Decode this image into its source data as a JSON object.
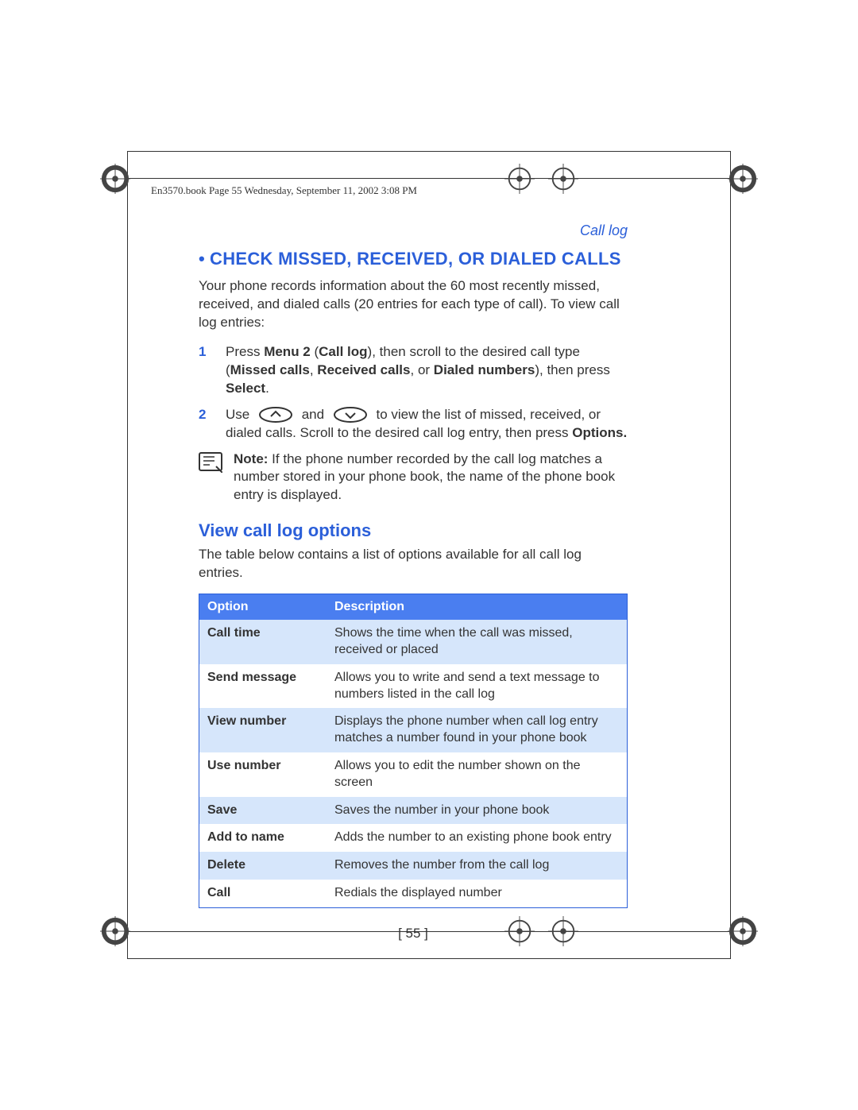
{
  "book_header": "En3570.book  Page 55  Wednesday, September 11, 2002  3:08 PM",
  "section_label": "Call log",
  "h1_bullet": "•",
  "h1": "CHECK MISSED, RECEIVED, OR DIALED CALLS",
  "intro": "Your phone records information about the 60 most recently missed, received, and dialed calls (20 entries for each type of call). To view call log entries:",
  "step1_num": "1",
  "step1_a": "Press ",
  "step1_b": "Menu 2",
  "step1_c": " (",
  "step1_d": "Call log",
  "step1_e": "), then scroll to the desired call type (",
  "step1_f": "Missed calls",
  "step1_g": ", ",
  "step1_h": "Received calls",
  "step1_i": ", or ",
  "step1_j": "Dialed numbers",
  "step1_k": "), then press ",
  "step1_l": "Select",
  "step1_m": ".",
  "step2_num": "2",
  "step2_a": "Use ",
  "step2_b": " and ",
  "step2_c": " to view the list of missed, received, or dialed calls. Scroll to the desired call log entry, then press ",
  "step2_d": "Options.",
  "note_a": "Note:",
  "note_b": " If the phone number recorded by the call log matches a number stored in your phone book, the name of the phone book entry is displayed.",
  "h2": "View call log options",
  "table_intro": "The table below contains a list of options available for all call log entries.",
  "table": {
    "header_option": "Option",
    "header_desc": "Description",
    "rows": [
      {
        "opt": "Call time",
        "desc": "Shows the time when the call was missed, received or placed"
      },
      {
        "opt": "Send message",
        "desc": "Allows you to write and send a text message to numbers listed in the call log"
      },
      {
        "opt": "View number",
        "desc": "Displays the phone number when call log entry matches a number found in your phone book"
      },
      {
        "opt": "Use number",
        "desc": "Allows you to edit the number shown on the screen"
      },
      {
        "opt": "Save",
        "desc": "Saves the number in your phone book"
      },
      {
        "opt": "Add to name",
        "desc": "Adds the number to an existing phone book entry"
      },
      {
        "opt": "Delete",
        "desc": "Removes the number from the call log"
      },
      {
        "opt": "Call",
        "desc": "Redials the displayed number"
      }
    ]
  },
  "page_num": "[ 55 ]"
}
